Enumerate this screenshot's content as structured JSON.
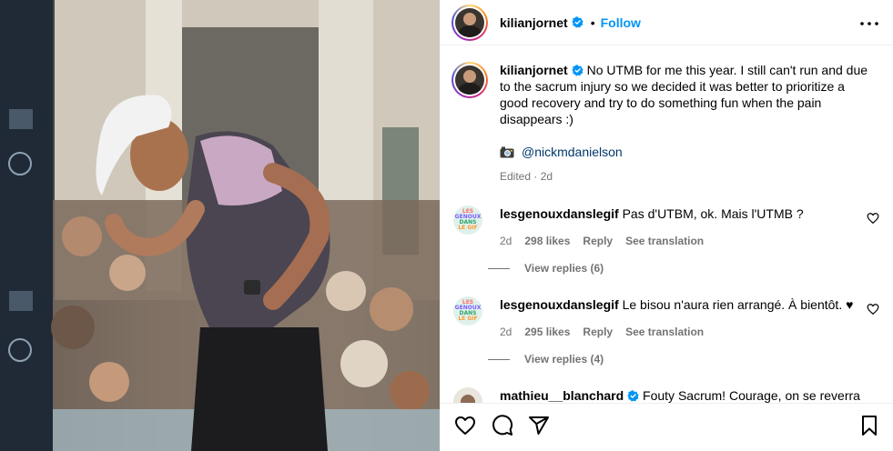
{
  "post": {
    "username": "kilianjornet",
    "dot": "•",
    "follow_label": "Follow",
    "caption": "No UTMB for me this year. I still can't run and due to the sacrum injury so we decided it was better to prioritize a good recovery and try to do something fun when the pain disappears :)",
    "photo_credit": "@nickmdanielson",
    "edited_meta": "Edited · 2d"
  },
  "comments": [
    {
      "username": "lesgenouxdanslegif",
      "text": "Pas d'UTBM, ok. Mais l'UTMB ?",
      "age": "2d",
      "likes": "298 likes",
      "reply_label": "Reply",
      "translate_label": "See translation",
      "view_replies": "View replies (6)",
      "avatar_lines": [
        "LES",
        "GENOUX",
        "DANS",
        "LE GIF"
      ]
    },
    {
      "username": "lesgenouxdanslegif",
      "text": "Le bisou n'aura rien arrangé. À bientôt. ♥",
      "age": "2d",
      "likes": "295 likes",
      "reply_label": "Reply",
      "translate_label": "See translation",
      "view_replies": "View replies (4)",
      "avatar_lines": [
        "LES",
        "GENOUX",
        "DANS",
        "LE GIF"
      ]
    },
    {
      "username": "mathieu__blanchard",
      "text": "Fouty Sacrum! Courage, on se reverra"
    }
  ],
  "icons": {
    "verified": "verified-badge-icon",
    "more": "more-options-icon",
    "camera": "camera-emoji-icon",
    "like": "heart-icon",
    "comment": "comment-icon",
    "share": "share-icon",
    "save": "bookmark-icon"
  },
  "colors": {
    "accent": "#0095f6",
    "verified": "#0095f6",
    "meta": "#737373",
    "mention": "#00376b"
  }
}
